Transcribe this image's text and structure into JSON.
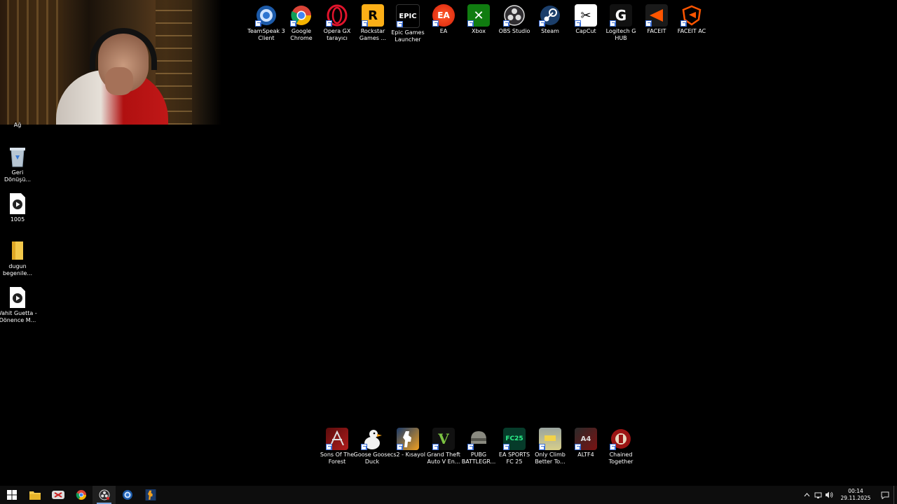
{
  "top_icons": [
    {
      "label": "TeamSpeak 3 Client",
      "icon": "teamspeak-icon"
    },
    {
      "label": "Google Chrome",
      "icon": "chrome-icon"
    },
    {
      "label": "Opera GX tarayıcı",
      "icon": "opera-gx-icon"
    },
    {
      "label": "Rockstar Games ...",
      "icon": "rockstar-icon"
    },
    {
      "label": "Epic Games Launcher",
      "icon": "epic-games-icon"
    },
    {
      "label": "EA",
      "icon": "ea-icon"
    },
    {
      "label": "Xbox",
      "icon": "xbox-icon"
    },
    {
      "label": "OBS Studio",
      "icon": "obs-icon"
    },
    {
      "label": "Steam",
      "icon": "steam-icon"
    },
    {
      "label": "CapCut",
      "icon": "capcut-icon"
    },
    {
      "label": "Logitech G HUB",
      "icon": "logitech-icon"
    },
    {
      "label": "FACEIT",
      "icon": "faceit-icon"
    },
    {
      "label": "FACEIT AC",
      "icon": "faceit-ac-icon"
    }
  ],
  "left_icons": [
    {
      "label": "Ağ",
      "icon": "network-icon"
    },
    {
      "label": "Geri Dönüşü...",
      "icon": "recycle-bin-icon"
    },
    {
      "label": "1005",
      "icon": "video-file-icon"
    },
    {
      "label": "dugun begenile...",
      "icon": "folder-icon"
    },
    {
      "label": "Vahit Guetta - Dönence M...",
      "icon": "video-file-icon"
    }
  ],
  "bottom_icons": [
    {
      "label": "Sons Of The Forest",
      "icon": "sons-of-the-forest-icon"
    },
    {
      "label": "Goose Goose Duck",
      "icon": "goose-goose-duck-icon"
    },
    {
      "label": "cs2 - Kısayol",
      "icon": "cs2-icon"
    },
    {
      "label": "Grand Theft Auto V En...",
      "icon": "gta-v-icon"
    },
    {
      "label": "PUBG BATTLEGR...",
      "icon": "pubg-icon"
    },
    {
      "label": "EA SPORTS FC 25",
      "icon": "ea-fc25-icon"
    },
    {
      "label": "Only Climb Better To...",
      "icon": "only-climb-icon"
    },
    {
      "label": "ALTF4",
      "icon": "altf4-icon"
    },
    {
      "label": "Chained Together",
      "icon": "chained-together-icon"
    }
  ],
  "icon_glyphs": {
    "epic": "EPIC",
    "ea": "EA",
    "rockstar": "R",
    "xbox": "✕",
    "capcut": "✂",
    "logitech": "G",
    "pubg": "PUBG",
    "fc25": "FC25",
    "gta": "V",
    "altf4": "A4"
  },
  "taskbar": {
    "apps": [
      "start-icon",
      "file-explorer-icon",
      "capcut-taskbar-icon",
      "chrome-taskbar-icon",
      "obs-taskbar-icon",
      "teamspeak-taskbar-icon",
      "cs2-taskbar-icon"
    ],
    "time": "00:14",
    "date": "29.11.2025"
  },
  "colors": {
    "desktop_bg": "#000000",
    "taskbar_bg": "#0d0d0d"
  }
}
